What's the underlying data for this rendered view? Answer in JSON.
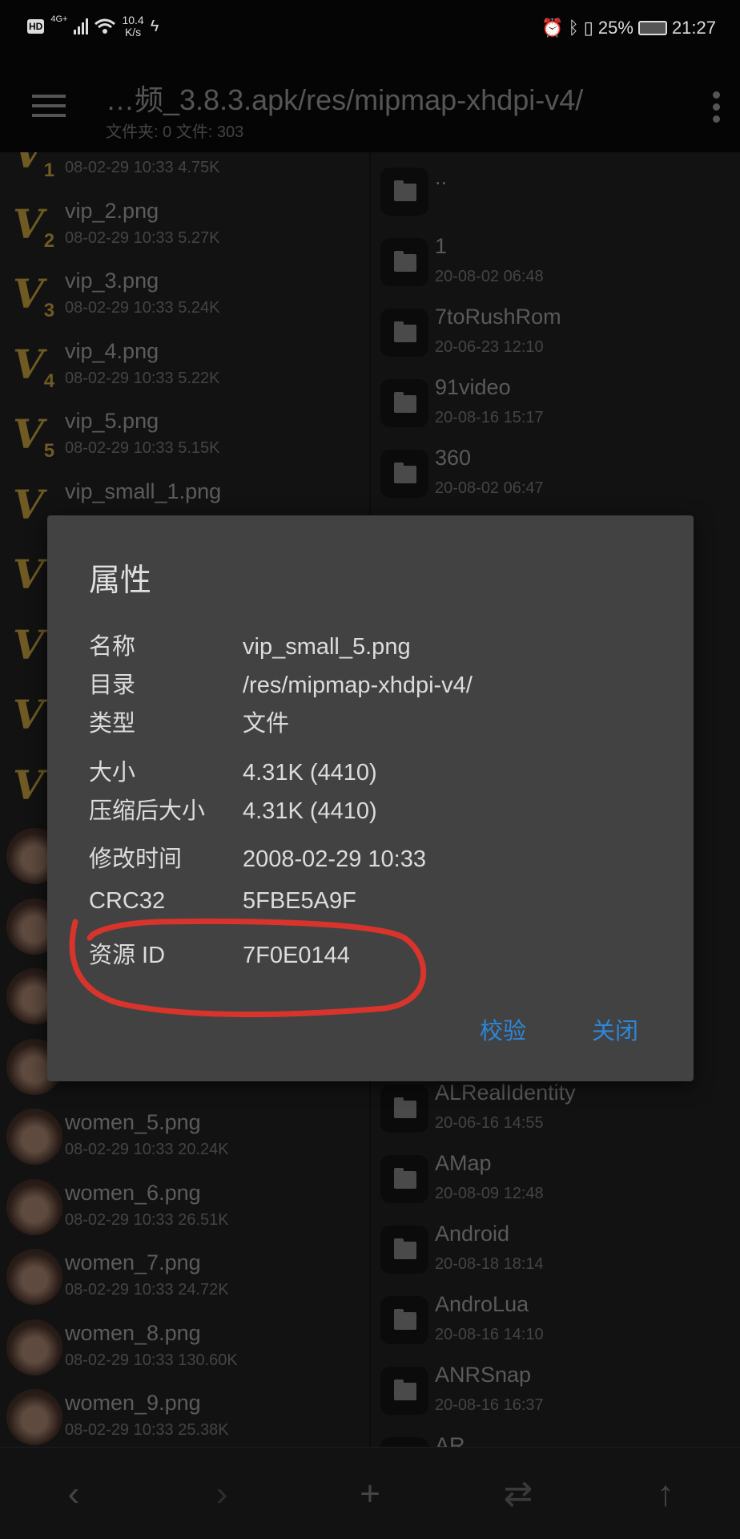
{
  "status_bar": {
    "hd": "HD",
    "network": "4G+",
    "speed_value": "10.4",
    "speed_unit": "K/s",
    "battery": "25%",
    "time": "21:27",
    "icons": [
      "hd-icon",
      "signal-icon",
      "wifi-icon",
      "charging-bolt-icon",
      "alarm-icon",
      "bluetooth-icon",
      "vibrate-icon",
      "battery-icon"
    ]
  },
  "toolbar": {
    "title": "…频_3.8.3.apk/res/mipmap-xhdpi-v4/",
    "subtitle": "文件夹: 0  文件: 303"
  },
  "left_pane": {
    "items": [
      {
        "name": "",
        "meta": "08-02-29 10:33  4.75K",
        "icon": "vip",
        "badge": "1",
        "index": 0
      },
      {
        "name": "vip_2.png",
        "meta": "08-02-29 10:33  5.27K",
        "icon": "vip",
        "badge": "2",
        "index": 1
      },
      {
        "name": "vip_3.png",
        "meta": "08-02-29 10:33  5.24K",
        "icon": "vip",
        "badge": "3",
        "index": 2
      },
      {
        "name": "vip_4.png",
        "meta": "08-02-29 10:33  5.22K",
        "icon": "vip",
        "badge": "4",
        "index": 3
      },
      {
        "name": "vip_5.png",
        "meta": "08-02-29 10:33  5.15K",
        "icon": "vip",
        "badge": "5",
        "index": 4
      },
      {
        "name": "vip_small_1.png",
        "meta": "",
        "icon": "vip",
        "badge": "",
        "index": 5
      },
      {
        "name": "",
        "meta": "",
        "icon": "vip",
        "badge": "",
        "index": 6
      },
      {
        "name": "",
        "meta": "",
        "icon": "vip",
        "badge": "",
        "index": 7
      },
      {
        "name": "",
        "meta": "",
        "icon": "vip",
        "badge": "",
        "index": 8
      },
      {
        "name": "",
        "meta": "",
        "icon": "vip",
        "badge": "",
        "index": 9
      },
      {
        "name": "",
        "meta": "",
        "icon": "avatar",
        "index": 10
      },
      {
        "name": "",
        "meta": "",
        "icon": "avatar",
        "index": 11
      },
      {
        "name": "",
        "meta": "",
        "icon": "avatar",
        "index": 12
      },
      {
        "name": "",
        "meta": "",
        "icon": "avatar",
        "index": 13
      },
      {
        "name": "women_5.png",
        "meta": "08-02-29 10:33  20.24K",
        "icon": "avatar",
        "index": 14
      },
      {
        "name": "women_6.png",
        "meta": "08-02-29 10:33  26.51K",
        "icon": "avatar",
        "index": 15
      },
      {
        "name": "women_7.png",
        "meta": "08-02-29 10:33  24.72K",
        "icon": "avatar",
        "index": 16
      },
      {
        "name": "women_8.png",
        "meta": "08-02-29 10:33  130.60K",
        "icon": "avatar",
        "index": 17
      },
      {
        "name": "women_9.png",
        "meta": "08-02-29 10:33  25.38K",
        "icon": "avatar",
        "index": 18
      }
    ]
  },
  "right_pane": {
    "items": [
      {
        "name": "..",
        "meta": "",
        "index": 0
      },
      {
        "name": "1",
        "meta": "20-08-02 06:48",
        "index": 1
      },
      {
        "name": "7toRushRom",
        "meta": "20-06-23 12:10",
        "index": 2
      },
      {
        "name": "91video",
        "meta": "20-08-16 15:17",
        "index": 3
      },
      {
        "name": "360",
        "meta": "20-08-02 06:47",
        "index": 4
      },
      {
        "name": "ALRealIdentity",
        "meta": "20-06-16 14:55",
        "index": 13
      },
      {
        "name": "AMap",
        "meta": "20-08-09 12:48",
        "index": 14
      },
      {
        "name": "Android",
        "meta": "20-08-18 18:14",
        "index": 15
      },
      {
        "name": "AndroLua",
        "meta": "20-08-16 14:10",
        "index": 16
      },
      {
        "name": "ANRSnap",
        "meta": "20-08-16 16:37",
        "index": 17
      },
      {
        "name": "AR",
        "meta": "",
        "index": 18
      }
    ]
  },
  "bottom_bar": {
    "back": "‹",
    "forward": "›",
    "add": "+",
    "swap": "⇄",
    "up": "↑"
  },
  "dialog": {
    "title": "属性",
    "rows": [
      {
        "label": "名称",
        "value": "vip_small_5.png"
      },
      {
        "label": "目录",
        "value": "/res/mipmap-xhdpi-v4/"
      },
      {
        "label": "类型",
        "value": "文件"
      },
      {
        "label": "大小",
        "value": "4.31K (4410)"
      },
      {
        "label": "压缩后大小",
        "value": "4.31K (4410)"
      },
      {
        "label": "修改时间",
        "value": "2008-02-29 10:33"
      },
      {
        "label": "CRC32",
        "value": "5FBE5A9F"
      },
      {
        "label": "资源 ID",
        "value": "7F0E0144"
      }
    ],
    "verify_label": "校验",
    "close_label": "关闭",
    "accent_color": "#2d87d9"
  },
  "annotation": {
    "color": "#d9342b",
    "shape": "hand-drawn circle around 资源 ID row"
  }
}
